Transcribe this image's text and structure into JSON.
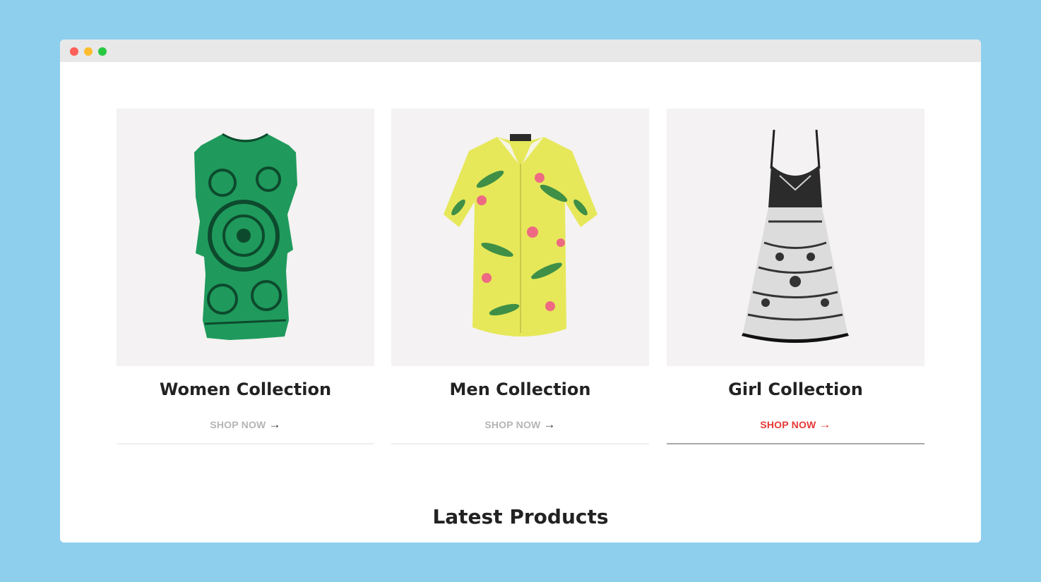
{
  "colors": {
    "background": "#8ecfee",
    "card_image_bg": "#f4f2f2",
    "accent": "#e53935",
    "muted_link": "#b5b5b5"
  },
  "collections": [
    {
      "title": "Women Collection",
      "link": "SHOP NOW",
      "active": false
    },
    {
      "title": "Men Collection",
      "link": "SHOP NOW",
      "active": false
    },
    {
      "title": "Girl Collection",
      "link": "SHOP NOW",
      "active": true
    }
  ],
  "latest": {
    "heading": "Latest Products"
  }
}
